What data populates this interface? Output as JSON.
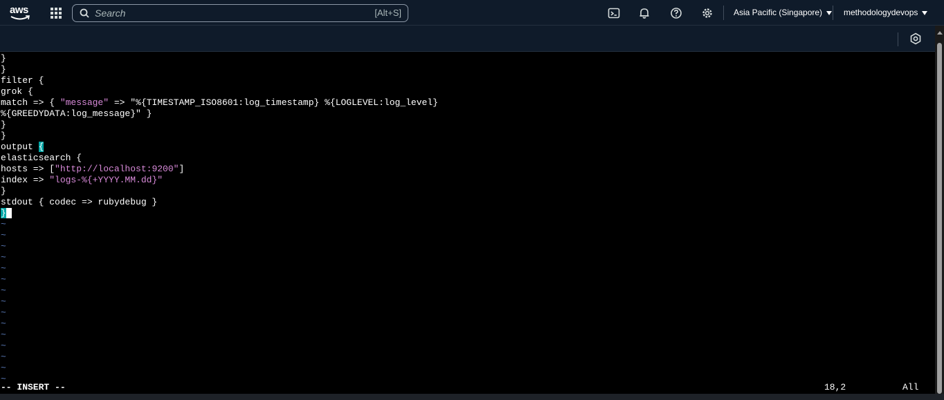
{
  "nav": {
    "logo_text": "aws",
    "search_placeholder": "Search",
    "search_shortcut": "[Alt+S]",
    "region": "Asia Pacific (Singapore)",
    "account": "methodologydevops",
    "icons": [
      "cloudshell-icon",
      "bell-icon",
      "help-icon",
      "gear-icon"
    ]
  },
  "terminal": {
    "lines": [
      [
        {
          "t": "}"
        }
      ],
      [
        {
          "t": "}"
        }
      ],
      [
        {
          "t": "filter {"
        }
      ],
      [
        {
          "t": "grok {"
        }
      ],
      [
        {
          "t": "match => { "
        },
        {
          "t": "\"message\"",
          "c": "str"
        },
        {
          "t": " => \"%{TIMESTAMP_ISO8601:log_timestamp} %{LOGLEVEL:log_level}"
        }
      ],
      [
        {
          "t": "%{GREEDYDATA:log_message}\" }"
        }
      ],
      [
        {
          "t": "}"
        }
      ],
      [
        {
          "t": "}"
        }
      ],
      [
        {
          "t": "output "
        },
        {
          "t": "{",
          "c": "hl"
        }
      ],
      [
        {
          "t": "elasticsearch {"
        }
      ],
      [
        {
          "t": "hosts => ["
        },
        {
          "t": "\"http://localhost:9200\"",
          "c": "str"
        },
        {
          "t": "]"
        }
      ],
      [
        {
          "t": "index => "
        },
        {
          "t": "\"logs-%{+YYYY.MM.dd}\"",
          "c": "str"
        }
      ],
      [
        {
          "t": "}"
        }
      ],
      [
        {
          "t": "stdout { codec => rubydebug }"
        }
      ],
      [
        {
          "t": "}",
          "c": "hl"
        },
        {
          "t": " ",
          "c": "cursor"
        }
      ],
      [
        {
          "t": "~",
          "c": "tilde"
        }
      ],
      [
        {
          "t": "~",
          "c": "tilde"
        }
      ],
      [
        {
          "t": "~",
          "c": "tilde"
        }
      ],
      [
        {
          "t": "~",
          "c": "tilde"
        }
      ],
      [
        {
          "t": "~",
          "c": "tilde"
        }
      ],
      [
        {
          "t": "~",
          "c": "tilde"
        }
      ],
      [
        {
          "t": "~",
          "c": "tilde"
        }
      ],
      [
        {
          "t": "~",
          "c": "tilde"
        }
      ],
      [
        {
          "t": "~",
          "c": "tilde"
        }
      ],
      [
        {
          "t": "~",
          "c": "tilde"
        }
      ],
      [
        {
          "t": "~",
          "c": "tilde"
        }
      ],
      [
        {
          "t": "~",
          "c": "tilde"
        }
      ],
      [
        {
          "t": "~",
          "c": "tilde"
        }
      ],
      [
        {
          "t": "~",
          "c": "tilde"
        }
      ],
      [
        {
          "t": "~",
          "c": "tilde"
        }
      ]
    ],
    "status_mode": "-- INSERT --",
    "status_position": "18,2",
    "status_scroll": "All"
  },
  "colors": {
    "nav_bg": "#0f1b2a",
    "string_color": "#d88ad9",
    "match_highlight": "#00a6a6",
    "tilde_color": "#5a7ab8"
  }
}
